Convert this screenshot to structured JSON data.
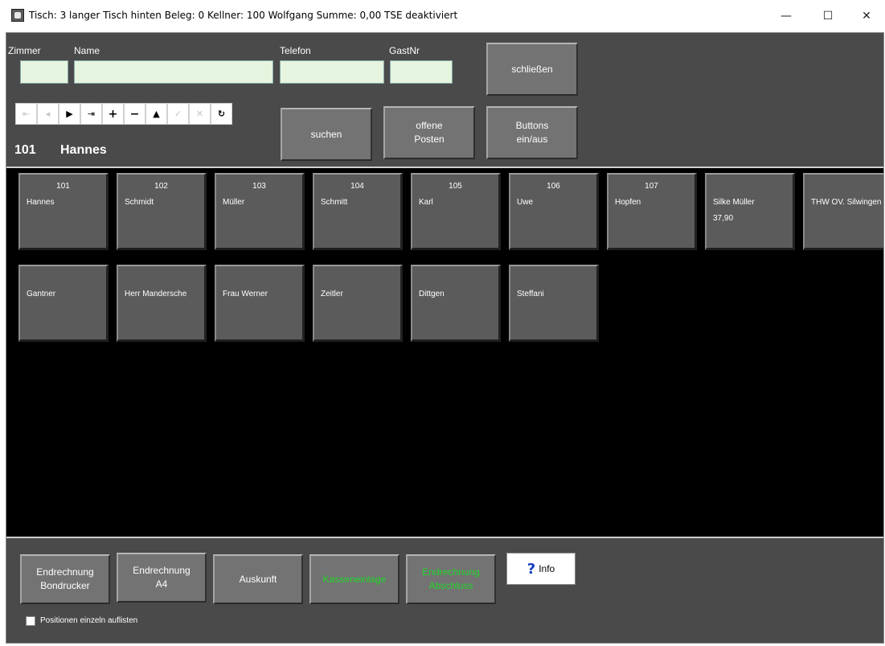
{
  "window": {
    "title": "Tisch: 3 langer Tisch hinten  Beleg: 0  Kellner: 100 Wolfgang  Summe: 0,00  TSE deaktiviert",
    "minimize": "—",
    "maximize": "☐",
    "close": "✕"
  },
  "form": {
    "labels": {
      "zimmer": "Zimmer",
      "name": "Name",
      "telefon": "Telefon",
      "gastnr": "GastNr"
    },
    "values": {
      "zimmer": "",
      "name": "",
      "telefon": "",
      "gastnr": ""
    }
  },
  "nav": {
    "first": "⇤",
    "prev": "◂",
    "next": "▶",
    "last": "⇥",
    "add": "+",
    "remove": "−",
    "up": "▲",
    "post": "✓",
    "cancel": "✕",
    "refresh": "↻"
  },
  "current": {
    "number": "101",
    "name": "Hannes"
  },
  "buttons": {
    "schliessen": "schließen",
    "suchen": "suchen",
    "offene_posten": "offene\nPosten",
    "buttons_toggle": "Buttons\nein/aus"
  },
  "guests": [
    {
      "num": "101",
      "name": "Hannes",
      "sum": ""
    },
    {
      "num": "102",
      "name": "Schmidt",
      "sum": ""
    },
    {
      "num": "103",
      "name": "Müller",
      "sum": ""
    },
    {
      "num": "104",
      "name": "Schmitt",
      "sum": ""
    },
    {
      "num": "105",
      "name": "Karl",
      "sum": ""
    },
    {
      "num": "106",
      "name": "Uwe",
      "sum": ""
    },
    {
      "num": "107",
      "name": "Hopfen",
      "sum": ""
    },
    {
      "num": "",
      "name": "Silke Müller",
      "sum": "37,90"
    },
    {
      "num": "",
      "name": "THW OV. Silwingen",
      "sum": ""
    },
    {
      "num": "",
      "name": "Gantner",
      "sum": ""
    },
    {
      "num": "",
      "name": "Herr Mandersche",
      "sum": ""
    },
    {
      "num": "",
      "name": "Frau Werner",
      "sum": ""
    },
    {
      "num": "",
      "name": "Zeitler",
      "sum": ""
    },
    {
      "num": "",
      "name": "Dittgen",
      "sum": ""
    },
    {
      "num": "",
      "name": "Steffani",
      "sum": ""
    }
  ],
  "footer": {
    "endrechnung_bon": "Endrechnung\nBondrucker",
    "endrechnung_a4": "Endrechnung\nA4",
    "auskunft": "Auskunft",
    "kasseneinlage": "Kasseneinlage",
    "endrechnung_abschluss": "Endrechnung\nAbschluss",
    "info": "Info",
    "checkbox_label": "Positionen einzeln auflisten",
    "checkbox_checked": false
  },
  "colors": {
    "panel": "#4a4a4a",
    "button": "#737373",
    "field": "#e6f5e0",
    "disabled_text": "#22d62a"
  }
}
